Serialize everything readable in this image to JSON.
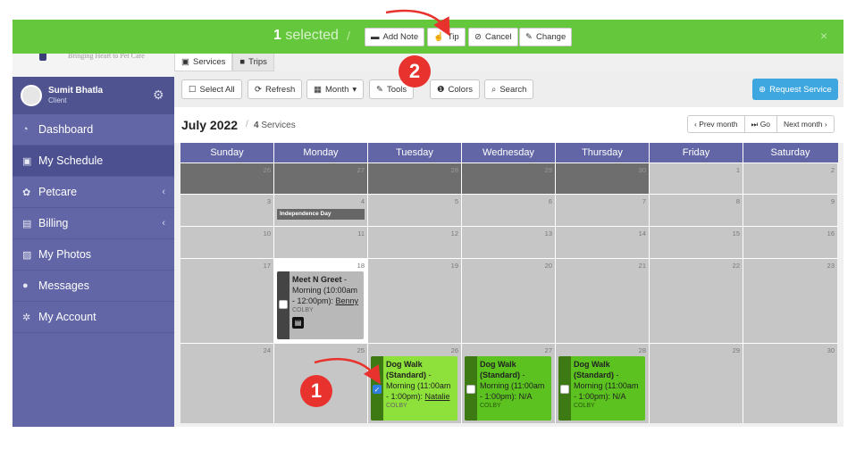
{
  "selection_bar": {
    "count": "1",
    "label": "selected",
    "slash": "/",
    "buttons": {
      "add_note": "Add Note",
      "tip": "Tip",
      "cancel": "Cancel",
      "change": "Change"
    },
    "close": "×"
  },
  "brand": {
    "tagline": "Bringing Heart to Pet Care"
  },
  "user": {
    "name": "Sumit Bhatla",
    "role": "Client"
  },
  "nav": [
    {
      "label": "Dashboard"
    },
    {
      "label": "My Schedule"
    },
    {
      "label": "Petcare"
    },
    {
      "label": "Billing"
    },
    {
      "label": "My Photos"
    },
    {
      "label": "Messages"
    },
    {
      "label": "My Account"
    }
  ],
  "tabs": {
    "services": "Services",
    "trips": "Trips"
  },
  "toolbar": {
    "select_all": "Select All",
    "refresh": "Refresh",
    "month": "Month",
    "tools": "Tools",
    "colors": "Colors",
    "search": "Search",
    "request_service": "Request Service"
  },
  "calendar": {
    "title": "July 2022",
    "sep": "/",
    "count": "4",
    "count_label": "Services",
    "pager": {
      "prev": "‹ Prev month",
      "go": "Go",
      "next": "Next month ›"
    },
    "days_of_week": [
      "Sunday",
      "Monday",
      "Tuesday",
      "Wednesday",
      "Thursday",
      "Friday",
      "Saturday"
    ],
    "weeks": [
      [
        "26",
        "27",
        "28",
        "29",
        "30",
        "1",
        "2"
      ],
      [
        "3",
        "4",
        "5",
        "6",
        "7",
        "8",
        "9"
      ],
      [
        "10",
        "11",
        "12",
        "13",
        "14",
        "15",
        "16"
      ],
      [
        "17",
        "18",
        "19",
        "20",
        "21",
        "22",
        "23"
      ],
      [
        "24",
        "25",
        "26",
        "27",
        "28",
        "29",
        "30"
      ]
    ],
    "holiday": "Independence Day",
    "events": {
      "meet": {
        "title": "Meet N Greet",
        "detail": " - Morning (10:00am - 12:00pm): ",
        "pet": "Benny",
        "sitter": "COLBY"
      },
      "walk1": {
        "title": "Dog Walk (Standard)",
        "detail": " - Morning (11:00am - 1:00pm): ",
        "pet": "Natalie",
        "sitter": "COLBY"
      },
      "walk2": {
        "title": "Dog Walk (Standard)",
        "detail": " - Morning (11:00am - 1:00pm): N/A",
        "sitter": "COLBY"
      },
      "walk3": {
        "title": "Dog Walk (Standard)",
        "detail": " - Morning (11:00am - 1:00pm): N/A",
        "sitter": "COLBY"
      }
    }
  },
  "annotations": {
    "one": "1",
    "two": "2"
  },
  "colors": {
    "selection_bar": "#65c73c",
    "sidebar": "#6266a6",
    "badge": "#e8322e",
    "request_button": "#3ea7e0"
  }
}
